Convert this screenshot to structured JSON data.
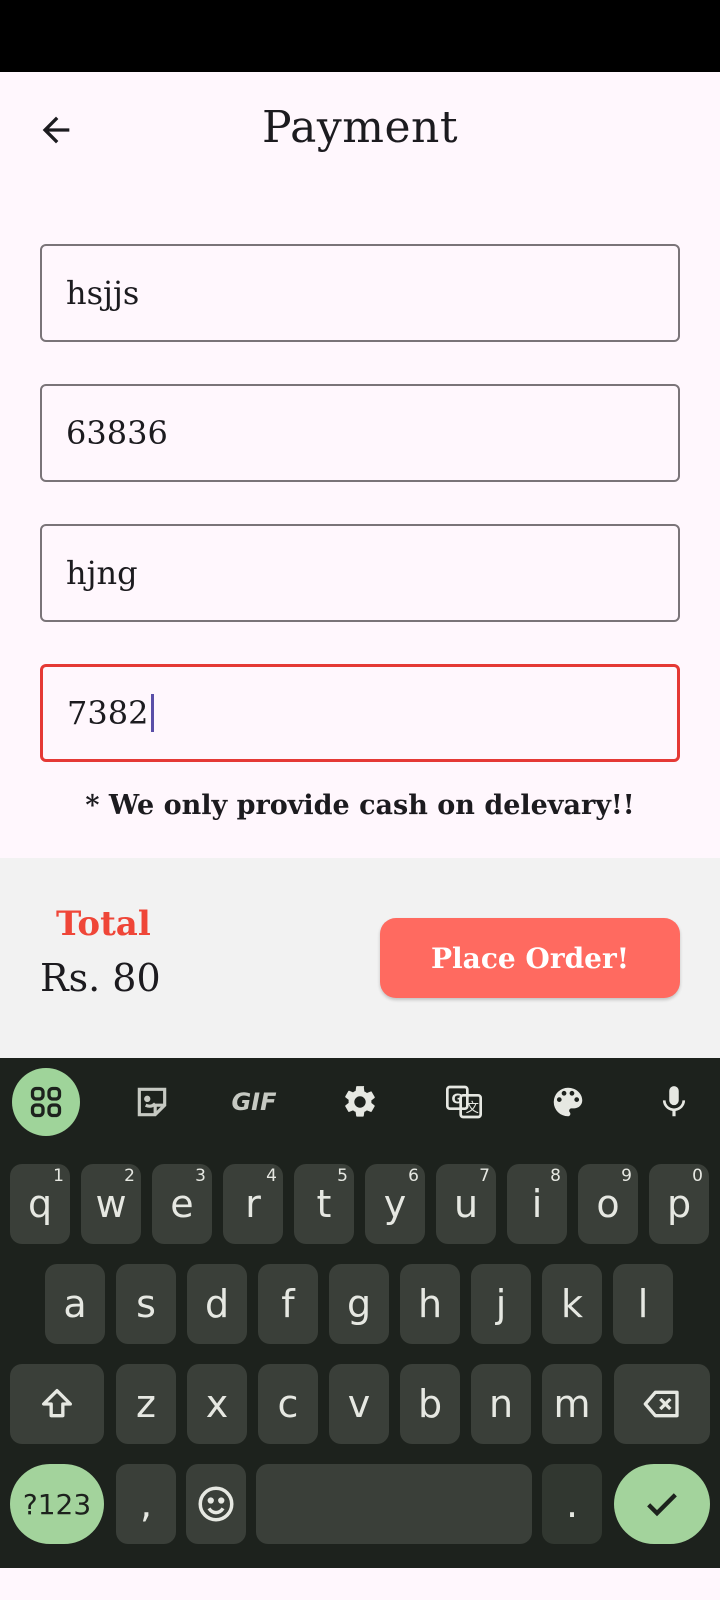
{
  "header": {
    "title": "Payment"
  },
  "form": {
    "name_value": "hsjjs",
    "pin_value": "63836",
    "address_value": "hjng",
    "phone_value": "7382"
  },
  "note": "* We only provide cash on delevary!!",
  "checkout": {
    "total_label": "Total",
    "total_value": "Rs. 80",
    "place_order_label": "Place Order!"
  },
  "keyboard": {
    "toolbar": [
      "apps-icon",
      "sticker-icon",
      "gif-icon",
      "settings-icon",
      "translate-icon",
      "palette-icon",
      "mic-icon"
    ],
    "gif_label": "GIF",
    "row1": [
      {
        "k": "q",
        "h": "1"
      },
      {
        "k": "w",
        "h": "2"
      },
      {
        "k": "e",
        "h": "3"
      },
      {
        "k": "r",
        "h": "4"
      },
      {
        "k": "t",
        "h": "5"
      },
      {
        "k": "y",
        "h": "6"
      },
      {
        "k": "u",
        "h": "7"
      },
      {
        "k": "i",
        "h": "8"
      },
      {
        "k": "o",
        "h": "9"
      },
      {
        "k": "p",
        "h": "0"
      }
    ],
    "row2": [
      "a",
      "s",
      "d",
      "f",
      "g",
      "h",
      "j",
      "k",
      "l"
    ],
    "row3": [
      "z",
      "x",
      "c",
      "v",
      "b",
      "n",
      "m"
    ],
    "sym_label": "?123",
    "comma": ",",
    "period": "."
  },
  "colors": {
    "accent_red": "#EF4638",
    "button": "#FF6A60",
    "error_border": "#E53935",
    "keyboard_bg": "#1D221D",
    "keyboard_accent": "#A3D39C"
  }
}
